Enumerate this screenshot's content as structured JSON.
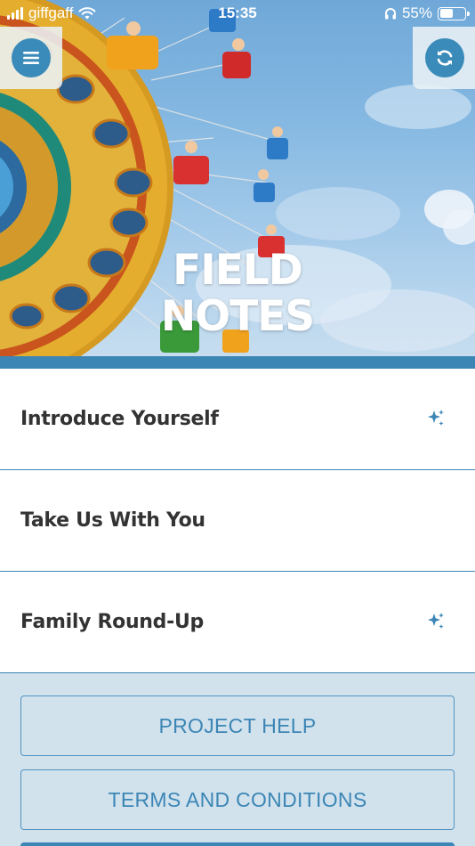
{
  "status_bar": {
    "carrier": "giffgaff",
    "time": "15:35",
    "battery_percent": "55%",
    "battery_level": 0.55
  },
  "header": {
    "menu_icon": "hamburger-menu-icon",
    "refresh_icon": "refresh-icon",
    "title_line1": "FIELD",
    "title_line2": "NOTES"
  },
  "list": {
    "items": [
      {
        "label": "Introduce Yourself",
        "icon": "sparkle-icon"
      },
      {
        "label": "Take Us With You",
        "icon": null
      },
      {
        "label": "Family Round-Up",
        "icon": "sparkle-icon"
      }
    ]
  },
  "footer": {
    "project_help_label": "PROJECT HELP",
    "terms_label": "TERMS AND CONDITIONS"
  },
  "colors": {
    "accent": "#3c86b5",
    "footer_bg": "#d1e2ed",
    "text_dark": "#333333"
  }
}
